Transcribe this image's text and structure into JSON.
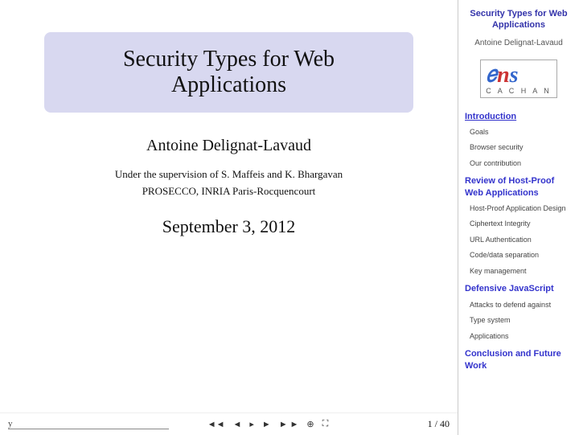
{
  "slide": {
    "title": "Security Types for Web Applications",
    "author": "Antoine Delignat-Lavaud",
    "supervisor_line1": "Under the supervision of S. Maffeis and K. Bhargavan",
    "supervisor_line2": "PROSECCO, INRIA Paris-Rocquencourt",
    "date": "September 3, 2012",
    "bottom_left_mark": "y",
    "page_indicator": "1 / 40"
  },
  "sidebar": {
    "title": "Security Types for Web Applications",
    "author": "Antoine Delignat-Lavaud",
    "logo": {
      "letters": "ens",
      "subtext": "C A C H A N"
    },
    "sections": [
      {
        "label": "Introduction",
        "active": true,
        "items": [
          "Goals",
          "Browser security",
          "Our contribution"
        ]
      },
      {
        "label": "Review of Host-Proof Web Applications",
        "active": false,
        "items": [
          "Host-Proof Application Design",
          "Ciphertext Integrity",
          "URL Authentication",
          "Code/data separation",
          "Key management"
        ]
      },
      {
        "label": "Defensive JavaScript",
        "active": false,
        "items": [
          "Attacks to defend against",
          "Type system",
          "Applications"
        ]
      },
      {
        "label": "Conclusion and Future Work",
        "active": false,
        "items": []
      }
    ]
  },
  "controls": {
    "prev_label": "◄",
    "nav_label": "▸",
    "next_label": "►",
    "zoom_label": "⊕∞"
  }
}
